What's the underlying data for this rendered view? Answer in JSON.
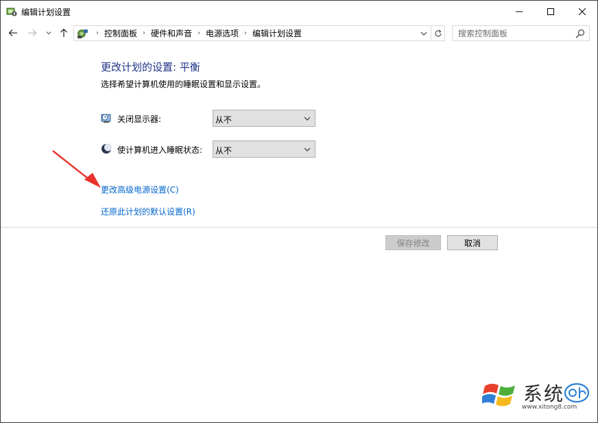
{
  "window": {
    "title": "编辑计划设置",
    "controls": {
      "minimize_icon": "minimize-icon",
      "maximize_icon": "maximize-icon",
      "close_icon": "close-icon"
    }
  },
  "navigation": {
    "back_icon": "arrow-left-icon",
    "forward_icon": "arrow-right-icon",
    "recent_icon": "chevron-down-icon",
    "up_icon": "arrow-up-icon"
  },
  "address": {
    "breadcrumbs": [
      "控制面板",
      "硬件和声音",
      "电源选项",
      "编辑计划设置"
    ],
    "dropdown_icon": "chevron-down-icon",
    "refresh_icon": "refresh-icon"
  },
  "search": {
    "placeholder": "搜索控制面板",
    "value": ""
  },
  "main": {
    "heading": "更改计划的设置: 平衡",
    "subheading": "选择希望计算机使用的睡眠设置和显示设置。",
    "settings": [
      {
        "label": "关闭显示器:",
        "value": "从不",
        "icon": "monitor-clock-icon"
      },
      {
        "label": "使计算机进入睡眠状态:",
        "value": "从不",
        "icon": "moon-sleep-icon"
      }
    ],
    "links": {
      "advanced": "更改高级电源设置(C)",
      "restore": "还原此计划的默认设置(R)"
    },
    "buttons": {
      "save": "保存修改",
      "cancel": "取消"
    }
  },
  "watermark": {
    "text": "系统",
    "url": "www.xitong8.com"
  },
  "colors": {
    "heading": "#1e3287",
    "link": "#0066cc",
    "annotation_arrow": "#e8332b"
  }
}
